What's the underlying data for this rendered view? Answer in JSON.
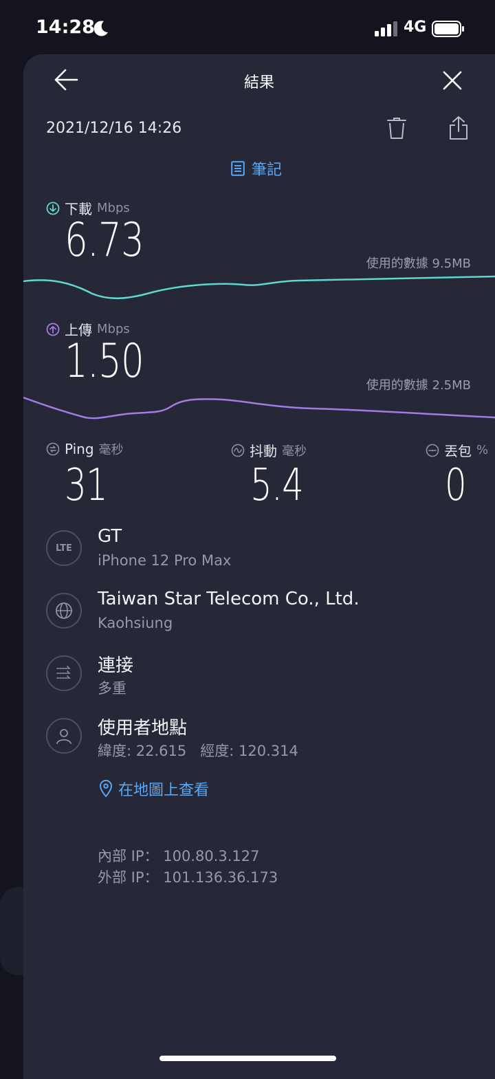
{
  "status_bar": {
    "time": "14:28",
    "network": "4G"
  },
  "header": {
    "title": "結果",
    "datetime": "2021/12/16 14:26",
    "notes_label": "筆記"
  },
  "download": {
    "label": "下載",
    "unit": "Mbps",
    "value": "6.73",
    "data_used": "使用的數據 9.5MB",
    "color": "#5fd8cf"
  },
  "upload": {
    "label": "上傳",
    "unit": "Mbps",
    "value": "1.50",
    "data_used": "使用的數據 2.5MB",
    "color": "#a27be5"
  },
  "stats": {
    "ping": {
      "label": "Ping",
      "unit": "毫秒",
      "value": "31"
    },
    "jitter": {
      "label": "抖動",
      "unit": "毫秒",
      "value": "5.4"
    },
    "loss": {
      "label": "丟包",
      "unit": "%",
      "value": "0"
    }
  },
  "info": {
    "carrier": {
      "badge": "LTE",
      "title": "GT",
      "sub": "iPhone 12 Pro Max"
    },
    "server": {
      "title": "Taiwan Star Telecom Co., Ltd.",
      "sub": "Kaohsiung"
    },
    "connection": {
      "title": "連接",
      "sub": "多重"
    },
    "location": {
      "title": "使用者地點",
      "lat_label": "緯度:",
      "lat": "22.615",
      "lon_label": "經度:",
      "lon": "120.314"
    }
  },
  "map_link": "在地圖上查看",
  "ip": {
    "internal_label": "內部 IP：",
    "internal": "100.80.3.127",
    "external_label": "外部 IP：",
    "external": "101.136.36.173"
  },
  "accent_color": "#58a9f5"
}
